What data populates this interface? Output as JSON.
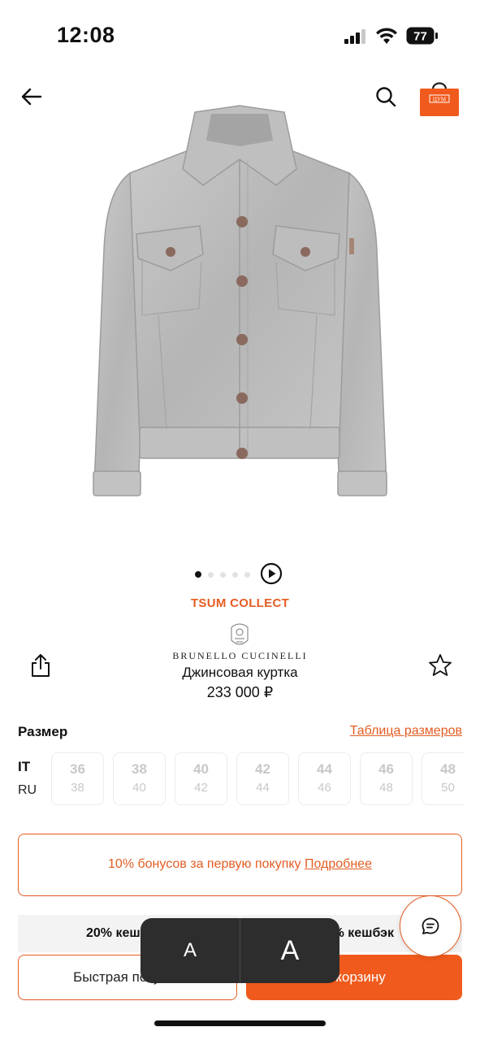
{
  "status": {
    "time": "12:08",
    "battery": "77"
  },
  "header": {
    "back_icon": "arrow-left-icon",
    "search_icon": "search-icon",
    "bag_icon": "shopping-bag-icon",
    "bag_badge": "ЦУМ"
  },
  "gallery": {
    "total_dots": 5,
    "active_index": 0,
    "play_icon": "play-icon"
  },
  "product": {
    "collection": "TSUM COLLECT",
    "brand": "BRUNELLO CUCINELLI",
    "name": "Джинсовая куртка",
    "price": "233 000 ₽"
  },
  "sizes": {
    "title": "Размер",
    "table_link": "Таблица размеров",
    "system_it": "IT",
    "system_ru": "RU",
    "items": [
      {
        "it": "36",
        "ru": "38"
      },
      {
        "it": "38",
        "ru": "40"
      },
      {
        "it": "40",
        "ru": "42"
      },
      {
        "it": "42",
        "ru": "44"
      },
      {
        "it": "44",
        "ru": "46"
      },
      {
        "it": "46",
        "ru": "48"
      },
      {
        "it": "48",
        "ru": "50"
      }
    ]
  },
  "bonus": {
    "text": "10% бонусов за первую покупку",
    "link": "Подробнее"
  },
  "cashback": {
    "left": "20% кешбэк",
    "right": "% кешбэк"
  },
  "actions": {
    "quick_buy": "Быстрая покупка",
    "add_to_cart": "В корзину"
  },
  "text_size": {
    "small": "A",
    "large": "A"
  },
  "colors": {
    "accent": "#e45d22",
    "cart_button": "#f05a1c",
    "overlay": "#2d2d2d"
  }
}
